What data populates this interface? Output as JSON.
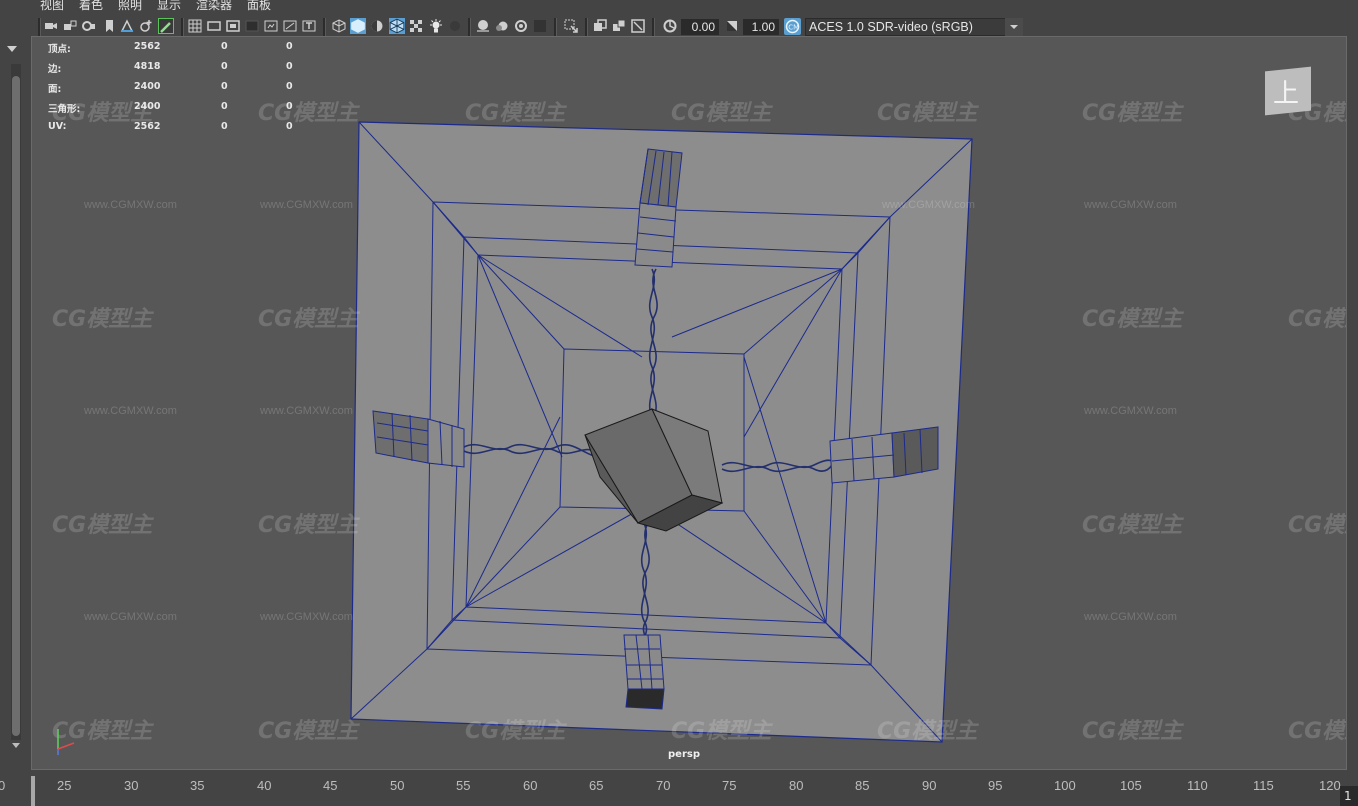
{
  "menu": [
    "视图",
    "着色",
    "照明",
    "显示",
    "渲染器",
    "面板"
  ],
  "toolbar": {
    "near_value": "0.00",
    "gamma_value": "1.00",
    "color_space": "ACES 1.0 SDR-video (sRGB)",
    "icons": [
      "camera-icon",
      "camera-lock-icon",
      "camera-attr-icon",
      "bookmark-icon",
      "image-plane-icon",
      "grease-pencil-icon",
      "grid-icon",
      "film-gate-icon",
      "resolution-gate-icon",
      "gate-mask-icon",
      "field-chart-icon",
      "safe-title-icon",
      "wireframe-icon",
      "smooth-shade-icon",
      "default-material-icon",
      "wireframe-on-shaded-icon",
      "textured-icon",
      "use-all-lights-icon",
      "shadows-icon",
      "screen-space-ao-icon",
      "motion-blur-icon",
      "anti-alias-icon",
      "depth-of-field-icon",
      "isolate-select-icon",
      "xray-icon",
      "xray-joints-icon",
      "xray-active-icon",
      "exposure-icon",
      "gamma-icon",
      "color-management-icon"
    ]
  },
  "hud": {
    "rows": [
      {
        "label": "顶点:",
        "v1": "2562",
        "v2": "0",
        "v3": "0"
      },
      {
        "label": "边:",
        "v1": "4818",
        "v2": "0",
        "v3": "0"
      },
      {
        "label": "面:",
        "v1": "2400",
        "v2": "0",
        "v3": "0"
      },
      {
        "label": "三角形:",
        "v1": "2400",
        "v2": "0",
        "v3": "0"
      },
      {
        "label": "UV:",
        "v1": "2562",
        "v2": "0",
        "v3": "0"
      }
    ]
  },
  "viewport": {
    "camera": "persp",
    "viewcube_label": "上",
    "watermark_logo": "CG模型主",
    "watermark_url": "www.CGMXW.com"
  },
  "timeline": {
    "ticks": [
      "0",
      "25",
      "30",
      "35",
      "40",
      "45",
      "50",
      "55",
      "60",
      "65",
      "70",
      "75",
      "80",
      "85",
      "90",
      "95",
      "100",
      "105",
      "110",
      "115",
      "120"
    ],
    "current_frame": "1"
  },
  "colors": {
    "wire": "#1c2a8c",
    "plate": "#8d8d8d",
    "viewport_bg": "#575757"
  }
}
